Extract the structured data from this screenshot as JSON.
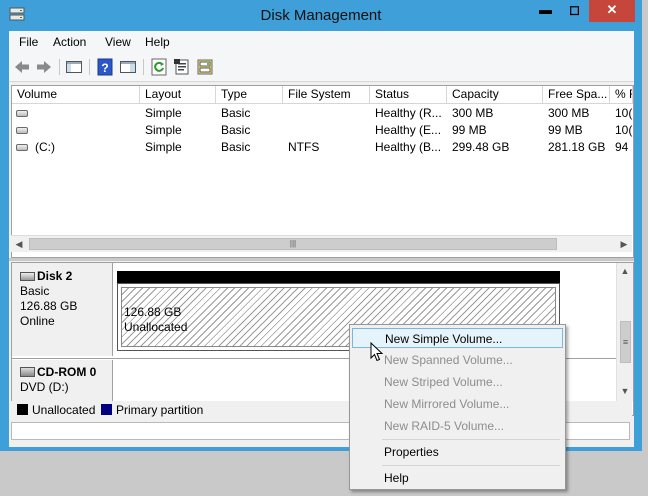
{
  "window": {
    "title": "Disk Management",
    "controls": {
      "minimize": "▬",
      "maximize": "◻",
      "close": "✕"
    }
  },
  "menu": [
    "File",
    "Action",
    "View",
    "Help"
  ],
  "toolbar": {
    "icons": [
      "back-arrow-icon",
      "forward-arrow-icon",
      "console-tree-icon",
      "help-icon",
      "show-pane-icon",
      "refresh-icon",
      "properties-icon",
      "rescan-icon"
    ]
  },
  "volume_list": {
    "columns": [
      "Volume",
      "Layout",
      "Type",
      "File System",
      "Status",
      "Capacity",
      "Free Spa...",
      "% F"
    ],
    "rows": [
      {
        "volume": "",
        "layout": "Simple",
        "type": "Basic",
        "fs": "",
        "status": "Healthy (R...",
        "capacity": "300 MB",
        "free": "300 MB",
        "pct": "10("
      },
      {
        "volume": "",
        "layout": "Simple",
        "type": "Basic",
        "fs": "",
        "status": "Healthy (E...",
        "capacity": "99 MB",
        "free": "99 MB",
        "pct": "10("
      },
      {
        "volume": "(C:)",
        "layout": "Simple",
        "type": "Basic",
        "fs": "NTFS",
        "status": "Healthy (B...",
        "capacity": "299.48 GB",
        "free": "281.18 GB",
        "pct": "94"
      }
    ]
  },
  "disks": [
    {
      "name": "Disk 2",
      "type": "Basic",
      "size": "126.88 GB",
      "state": "Online",
      "partition": {
        "size": "126.88 GB",
        "label": "Unallocated"
      }
    },
    {
      "name": "CD-ROM 0",
      "type": "DVD (D:)"
    }
  ],
  "legend": [
    {
      "label": "Unallocated",
      "color": "#000000"
    },
    {
      "label": "Primary partition",
      "color": "#000080"
    }
  ],
  "context_menu": {
    "items": [
      {
        "label": "New Simple Volume...",
        "enabled": true,
        "highlighted": true
      },
      {
        "label": "New Spanned Volume...",
        "enabled": false
      },
      {
        "label": "New Striped Volume...",
        "enabled": false
      },
      {
        "label": "New Mirrored Volume...",
        "enabled": false
      },
      {
        "label": "New RAID-5 Volume...",
        "enabled": false
      },
      {
        "label": "Properties",
        "enabled": true
      },
      {
        "label": "Help",
        "enabled": true
      }
    ]
  },
  "colors": {
    "frame": "#3f9fd8",
    "close_button": "#c7463b",
    "menu_highlight": "#e5f3fb"
  }
}
